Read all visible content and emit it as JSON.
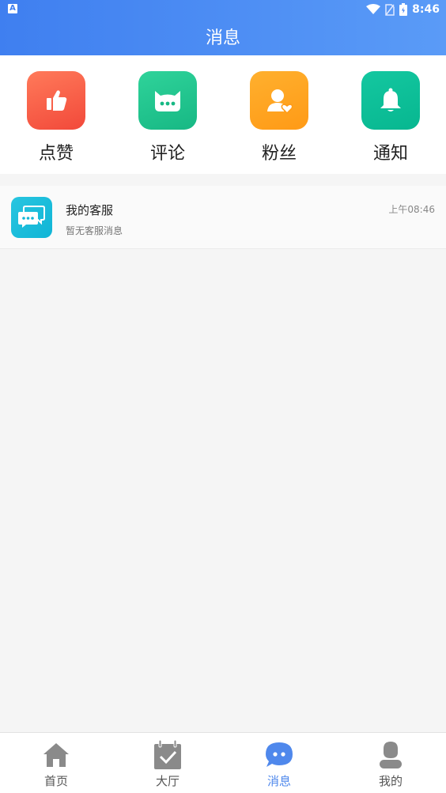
{
  "status_bar": {
    "time": "8:46",
    "indicator": "A"
  },
  "header": {
    "title": "消息"
  },
  "quick_actions": [
    {
      "label": "点赞",
      "icon": "thumbs-up-icon",
      "color_from": "#ff7a5a",
      "color_to": "#f2493a"
    },
    {
      "label": "评论",
      "icon": "cat-comment-icon",
      "color_from": "#2fd39a",
      "color_to": "#17b884"
    },
    {
      "label": "粉丝",
      "icon": "user-heart-icon",
      "color_from": "#ffb02e",
      "color_to": "#ff9a16"
    },
    {
      "label": "通知",
      "icon": "bell-icon",
      "color_from": "#14c7a0",
      "color_to": "#07b790"
    }
  ],
  "messages": [
    {
      "name": "我的客服",
      "time": "上午08:46",
      "preview": "暂无客服消息",
      "icon": "customer-service-icon"
    }
  ],
  "tabbar": {
    "items": [
      {
        "label": "首页",
        "icon": "home-icon",
        "active": false
      },
      {
        "label": "大厅",
        "icon": "calendar-check-icon",
        "active": false
      },
      {
        "label": "消息",
        "icon": "chat-bubble-icon",
        "active": true
      },
      {
        "label": "我的",
        "icon": "profile-icon",
        "active": false
      }
    ],
    "active_color": "#4f88ec",
    "inactive_color": "#8a8a8a"
  }
}
